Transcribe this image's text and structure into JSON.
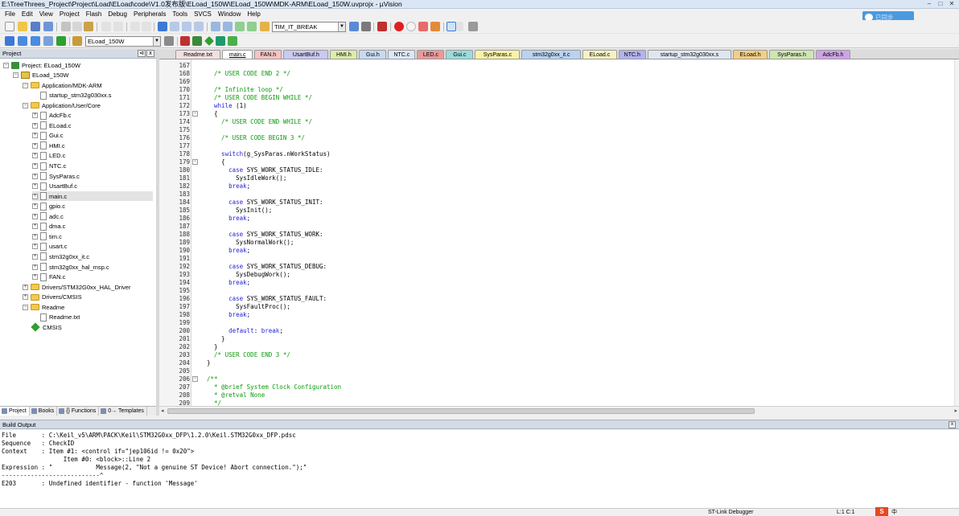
{
  "window": {
    "title": "E:\\TreeThrees_Project\\Project\\Load\\ELoad\\code\\V1.0发布版\\ELoad_150W\\ELoad_150W\\MDK-ARM\\ELoad_150W.uvprojx - µVision",
    "minimize": "–",
    "maximize": "□",
    "close": "✕"
  },
  "menubar": [
    "File",
    "Edit",
    "View",
    "Project",
    "Flash",
    "Debug",
    "Peripherals",
    "Tools",
    "SVCS",
    "Window",
    "Help"
  ],
  "cloud_widget": {
    "label": "已同步",
    "icon": "cloud-icon"
  },
  "toolbar": {
    "find_value": "TIM_IT_BREAK",
    "target_value": "ELoad_150W"
  },
  "project_panel": {
    "header": "Project",
    "pin": "⊲",
    "close": "x",
    "tree": [
      {
        "label": "Project: ELoad_150W",
        "level": 0,
        "icon": "project-icon",
        "expander": "−"
      },
      {
        "label": "ELoad_150W",
        "level": 1,
        "icon": "target-icon",
        "expander": "−"
      },
      {
        "label": "Application/MDK-ARM",
        "level": 2,
        "icon": "folder-open-icon",
        "expander": "−"
      },
      {
        "label": "startup_stm32g030xx.s",
        "level": 3,
        "icon": "file-icon",
        "expander": ""
      },
      {
        "label": "Application/User/Core",
        "level": 2,
        "icon": "folder-open-icon",
        "expander": "−"
      },
      {
        "label": "AdcFb.c",
        "level": 3,
        "icon": "file-icon",
        "expander": "+"
      },
      {
        "label": "ELoad.c",
        "level": 3,
        "icon": "file-icon",
        "expander": "+"
      },
      {
        "label": "Gui.c",
        "level": 3,
        "icon": "file-icon",
        "expander": "+"
      },
      {
        "label": "HMI.c",
        "level": 3,
        "icon": "file-icon",
        "expander": "+"
      },
      {
        "label": "LED.c",
        "level": 3,
        "icon": "file-icon",
        "expander": "+"
      },
      {
        "label": "NTC.c",
        "level": 3,
        "icon": "file-icon",
        "expander": "+"
      },
      {
        "label": "SysParas.c",
        "level": 3,
        "icon": "file-icon",
        "expander": "+"
      },
      {
        "label": "UsartBuf.c",
        "level": 3,
        "icon": "file-icon",
        "expander": "+"
      },
      {
        "label": "main.c",
        "level": 3,
        "icon": "file-icon",
        "expander": "+"
      },
      {
        "label": "gpio.c",
        "level": 3,
        "icon": "file-icon",
        "expander": "+"
      },
      {
        "label": "adc.c",
        "level": 3,
        "icon": "file-icon",
        "expander": "+"
      },
      {
        "label": "dma.c",
        "level": 3,
        "icon": "file-icon",
        "expander": "+"
      },
      {
        "label": "tim.c",
        "level": 3,
        "icon": "file-icon",
        "expander": "+"
      },
      {
        "label": "usart.c",
        "level": 3,
        "icon": "file-icon",
        "expander": "+"
      },
      {
        "label": "stm32g0xx_it.c",
        "level": 3,
        "icon": "file-icon",
        "expander": "+"
      },
      {
        "label": "stm32g0xx_hal_msp.c",
        "level": 3,
        "icon": "file-icon",
        "expander": "+"
      },
      {
        "label": "FAN.c",
        "level": 3,
        "icon": "file-icon",
        "expander": "+"
      },
      {
        "label": "Drivers/STM32G0xx_HAL_Driver",
        "level": 2,
        "icon": "folder-icon",
        "expander": "+"
      },
      {
        "label": "Drivers/CMSIS",
        "level": 2,
        "icon": "folder-icon",
        "expander": "+"
      },
      {
        "label": "Readme",
        "level": 2,
        "icon": "folder-open-icon",
        "expander": "−"
      },
      {
        "label": "Readme.txt",
        "level": 3,
        "icon": "file-icon",
        "expander": ""
      },
      {
        "label": "CMSIS",
        "level": 2,
        "icon": "cmsis-diamond-icon",
        "expander": ""
      }
    ],
    "bottom_tabs": [
      "Project",
      "Books",
      "{} Functions",
      "0→ Templates"
    ]
  },
  "editor_tabs": [
    {
      "label": "Readme.txt",
      "color": "#f2e0e0",
      "active": false
    },
    {
      "label": "main.c",
      "color": "#ffffff",
      "active": true
    },
    {
      "label": "FAN.h",
      "color": "#f6c3c3",
      "active": false
    },
    {
      "label": "UsartBuf.h",
      "color": "#c9c9f2",
      "active": false
    },
    {
      "label": "HMI.h",
      "color": "#dcedaa",
      "active": false
    },
    {
      "label": "Gui.h",
      "color": "#c9d9f2",
      "active": false
    },
    {
      "label": "NTC.c",
      "color": "#dde8f6",
      "active": false
    },
    {
      "label": "LED.c",
      "color": "#e89a9a",
      "active": false
    },
    {
      "label": "Gui.c",
      "color": "#9adcdc",
      "active": false
    },
    {
      "label": "SysParas.c",
      "color": "#f8f2a8",
      "active": false
    },
    {
      "label": "stm32g0xx_it.c",
      "color": "#b9d3f2",
      "active": false
    },
    {
      "label": "ELoad.c",
      "color": "#f6f2c3",
      "active": false
    },
    {
      "label": "NTC.h",
      "color": "#b3b3ee",
      "active": false
    },
    {
      "label": "startup_stm32g030xx.s",
      "color": "#dfe6f0",
      "active": false
    },
    {
      "label": "ELoad.h",
      "color": "#f3cf84",
      "active": false
    },
    {
      "label": "SysParas.h",
      "color": "#cfe6b3",
      "active": false
    },
    {
      "label": "AdcFb.h",
      "color": "#cfa3e6",
      "active": false
    }
  ],
  "code_lines": [
    {
      "n": "167",
      "fold": "",
      "parts": []
    },
    {
      "n": "168",
      "fold": "",
      "parts": [
        {
          "c": "cm",
          "t": "  /* USER CODE END 2 */"
        }
      ]
    },
    {
      "n": "169",
      "fold": "",
      "parts": []
    },
    {
      "n": "170",
      "fold": "",
      "parts": [
        {
          "c": "cm",
          "t": "  /* Infinite loop */"
        }
      ]
    },
    {
      "n": "171",
      "fold": "",
      "parts": [
        {
          "c": "cm",
          "t": "  /* USER CODE BEGIN WHILE */"
        }
      ]
    },
    {
      "n": "172",
      "fold": "",
      "parts": [
        {
          "c": "kw",
          "t": "  while"
        },
        {
          "c": "tx",
          "t": " (1)"
        }
      ]
    },
    {
      "n": "173",
      "fold": "−",
      "parts": [
        {
          "c": "tx",
          "t": "  {"
        }
      ]
    },
    {
      "n": "174",
      "fold": "",
      "parts": [
        {
          "c": "cm",
          "t": "    /* USER CODE END WHILE */"
        }
      ]
    },
    {
      "n": "175",
      "fold": "",
      "parts": []
    },
    {
      "n": "176",
      "fold": "",
      "parts": [
        {
          "c": "cm",
          "t": "    /* USER CODE BEGIN 3 */"
        }
      ]
    },
    {
      "n": "177",
      "fold": "",
      "parts": []
    },
    {
      "n": "178",
      "fold": "",
      "parts": [
        {
          "c": "kw",
          "t": "    switch"
        },
        {
          "c": "tx",
          "t": "(g_SysParas.nWorkStatus)"
        }
      ]
    },
    {
      "n": "179",
      "fold": "−",
      "parts": [
        {
          "c": "tx",
          "t": "    {"
        }
      ]
    },
    {
      "n": "180",
      "fold": "",
      "parts": [
        {
          "c": "kw",
          "t": "      case"
        },
        {
          "c": "tx",
          "t": " SYS_WORK_STATUS_IDLE:"
        }
      ]
    },
    {
      "n": "181",
      "fold": "",
      "parts": [
        {
          "c": "tx",
          "t": "        SysIdleWork();"
        }
      ]
    },
    {
      "n": "182",
      "fold": "",
      "parts": [
        {
          "c": "kw",
          "t": "      break"
        },
        {
          "c": "tx",
          "t": ";"
        }
      ]
    },
    {
      "n": "183",
      "fold": "",
      "parts": []
    },
    {
      "n": "184",
      "fold": "",
      "parts": [
        {
          "c": "kw",
          "t": "      case"
        },
        {
          "c": "tx",
          "t": " SYS_WORK_STATUS_INIT:"
        }
      ]
    },
    {
      "n": "185",
      "fold": "",
      "parts": [
        {
          "c": "tx",
          "t": "        SysInit();"
        }
      ]
    },
    {
      "n": "186",
      "fold": "",
      "parts": [
        {
          "c": "kw",
          "t": "      break"
        },
        {
          "c": "tx",
          "t": ";"
        }
      ]
    },
    {
      "n": "187",
      "fold": "",
      "parts": []
    },
    {
      "n": "188",
      "fold": "",
      "parts": [
        {
          "c": "kw",
          "t": "      case"
        },
        {
          "c": "tx",
          "t": " SYS_WORK_STATUS_WORK:"
        }
      ]
    },
    {
      "n": "189",
      "fold": "",
      "parts": [
        {
          "c": "tx",
          "t": "        SysNormalWork();"
        }
      ]
    },
    {
      "n": "190",
      "fold": "",
      "parts": [
        {
          "c": "kw",
          "t": "      break"
        },
        {
          "c": "tx",
          "t": ";"
        }
      ]
    },
    {
      "n": "191",
      "fold": "",
      "parts": []
    },
    {
      "n": "192",
      "fold": "",
      "parts": [
        {
          "c": "kw",
          "t": "      case"
        },
        {
          "c": "tx",
          "t": " SYS_WORK_STATUS_DEBUG:"
        }
      ]
    },
    {
      "n": "193",
      "fold": "",
      "parts": [
        {
          "c": "tx",
          "t": "        SysDebugWork();"
        }
      ]
    },
    {
      "n": "194",
      "fold": "",
      "parts": [
        {
          "c": "kw",
          "t": "      break"
        },
        {
          "c": "tx",
          "t": ";"
        }
      ]
    },
    {
      "n": "195",
      "fold": "",
      "parts": []
    },
    {
      "n": "196",
      "fold": "",
      "parts": [
        {
          "c": "kw",
          "t": "      case"
        },
        {
          "c": "tx",
          "t": " SYS_WORK_STATUS_FAULT:"
        }
      ]
    },
    {
      "n": "197",
      "fold": "",
      "parts": [
        {
          "c": "tx",
          "t": "        SysFaultProc();"
        }
      ]
    },
    {
      "n": "198",
      "fold": "",
      "parts": [
        {
          "c": "kw",
          "t": "      break"
        },
        {
          "c": "tx",
          "t": ";"
        }
      ]
    },
    {
      "n": "199",
      "fold": "",
      "parts": []
    },
    {
      "n": "200",
      "fold": "",
      "parts": [
        {
          "c": "kw",
          "t": "      default"
        },
        {
          "c": "tx",
          "t": ": "
        },
        {
          "c": "kw",
          "t": "break"
        },
        {
          "c": "tx",
          "t": ";"
        }
      ]
    },
    {
      "n": "201",
      "fold": "",
      "parts": [
        {
          "c": "tx",
          "t": "    }"
        }
      ]
    },
    {
      "n": "202",
      "fold": "",
      "parts": [
        {
          "c": "tx",
          "t": "  }"
        }
      ]
    },
    {
      "n": "203",
      "fold": "",
      "parts": [
        {
          "c": "cm",
          "t": "  /* USER CODE END 3 */"
        }
      ]
    },
    {
      "n": "204",
      "fold": "",
      "parts": [
        {
          "c": "tx",
          "t": "}"
        }
      ]
    },
    {
      "n": "205",
      "fold": "",
      "parts": []
    },
    {
      "n": "206",
      "fold": "−",
      "parts": [
        {
          "c": "cm",
          "t": "/**"
        }
      ]
    },
    {
      "n": "207",
      "fold": "",
      "parts": [
        {
          "c": "cm",
          "t": "  * @brief System Clock Configuration"
        }
      ]
    },
    {
      "n": "208",
      "fold": "",
      "parts": [
        {
          "c": "cm",
          "t": "  * @retval None"
        }
      ]
    },
    {
      "n": "209",
      "fold": "",
      "parts": [
        {
          "c": "cm",
          "t": "  */"
        }
      ]
    }
  ],
  "build_output": {
    "title": "Build Output",
    "close": "x",
    "lines": [
      "File       : C:\\Keil_v5\\ARM\\PACK\\Keil\\STM32G0xx_DFP\\1.2.0\\Keil.STM32G0xx_DFP.pdsc",
      "Sequence   : CheckID",
      "Context    : Item #1: <control if=\"jep106id != 0x20\">",
      "                 Item #0: <block>::Line 2",
      "Expression : \"            Message(2, \"Not a genuine ST Device! Abort connection.\");\"",
      "---------------------------^",
      "E203       : Undefined identifier - function 'Message'"
    ]
  },
  "statusbar": {
    "left": "ST-Link Debugger",
    "right": "L:1 C:1",
    "ime_badge": "S",
    "ime_text": "中"
  }
}
